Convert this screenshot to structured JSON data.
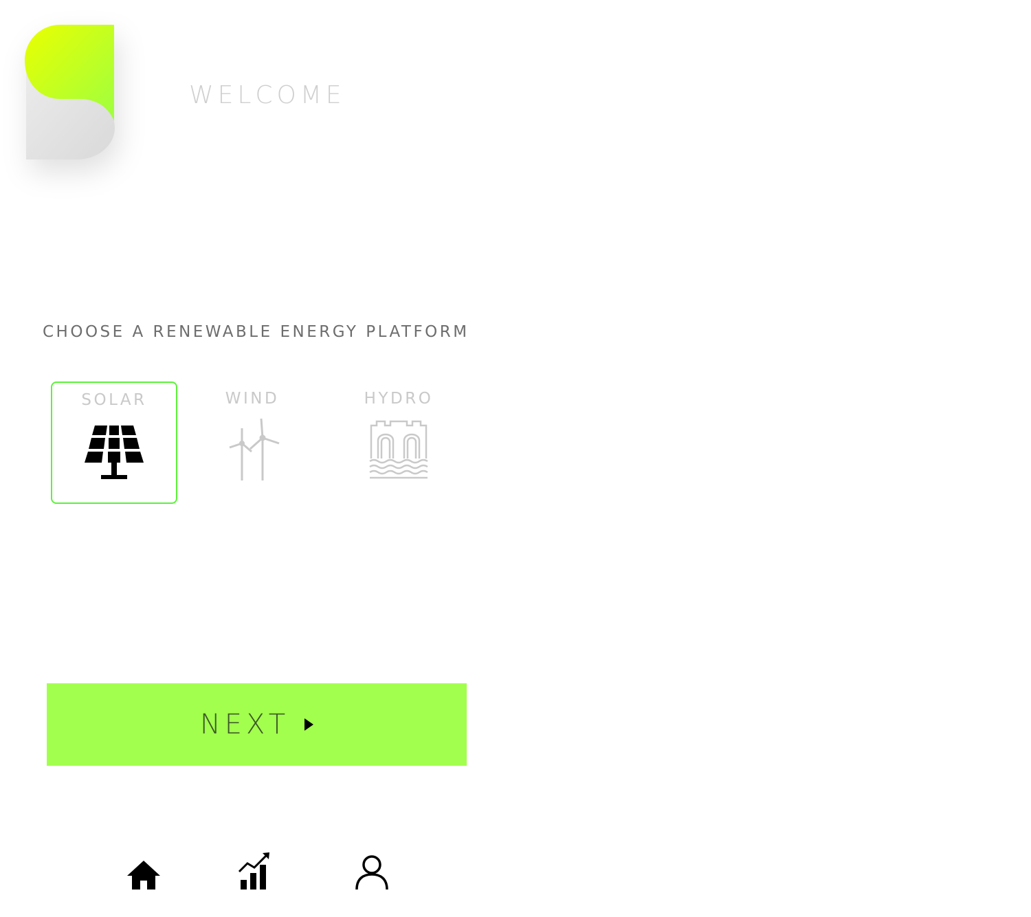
{
  "brand": {
    "accent_color": "#a3ff4d",
    "selected_border_color": "#5cf23a",
    "logo_gradient": [
      "#eaff00",
      "#9eff40"
    ]
  },
  "header": {
    "title": "WELCOME"
  },
  "platform_picker": {
    "heading": "CHOOSE A RENEWABLE ENERGY PLATFORM",
    "selected": "solar",
    "options": [
      {
        "id": "solar",
        "label": "SOLAR",
        "icon": "solar-panel-icon"
      },
      {
        "id": "wind",
        "label": "WIND",
        "icon": "wind-turbine-icon"
      },
      {
        "id": "hydro",
        "label": "HYDRO",
        "icon": "hydro-dam-icon"
      }
    ]
  },
  "actions": {
    "next_label": "NEXT",
    "next_icon": "play-arrow-icon"
  },
  "bottom_nav": {
    "items": [
      {
        "id": "home",
        "icon": "home-icon"
      },
      {
        "id": "stats",
        "icon": "stats-chart-icon"
      },
      {
        "id": "profile",
        "icon": "user-profile-icon"
      }
    ]
  }
}
